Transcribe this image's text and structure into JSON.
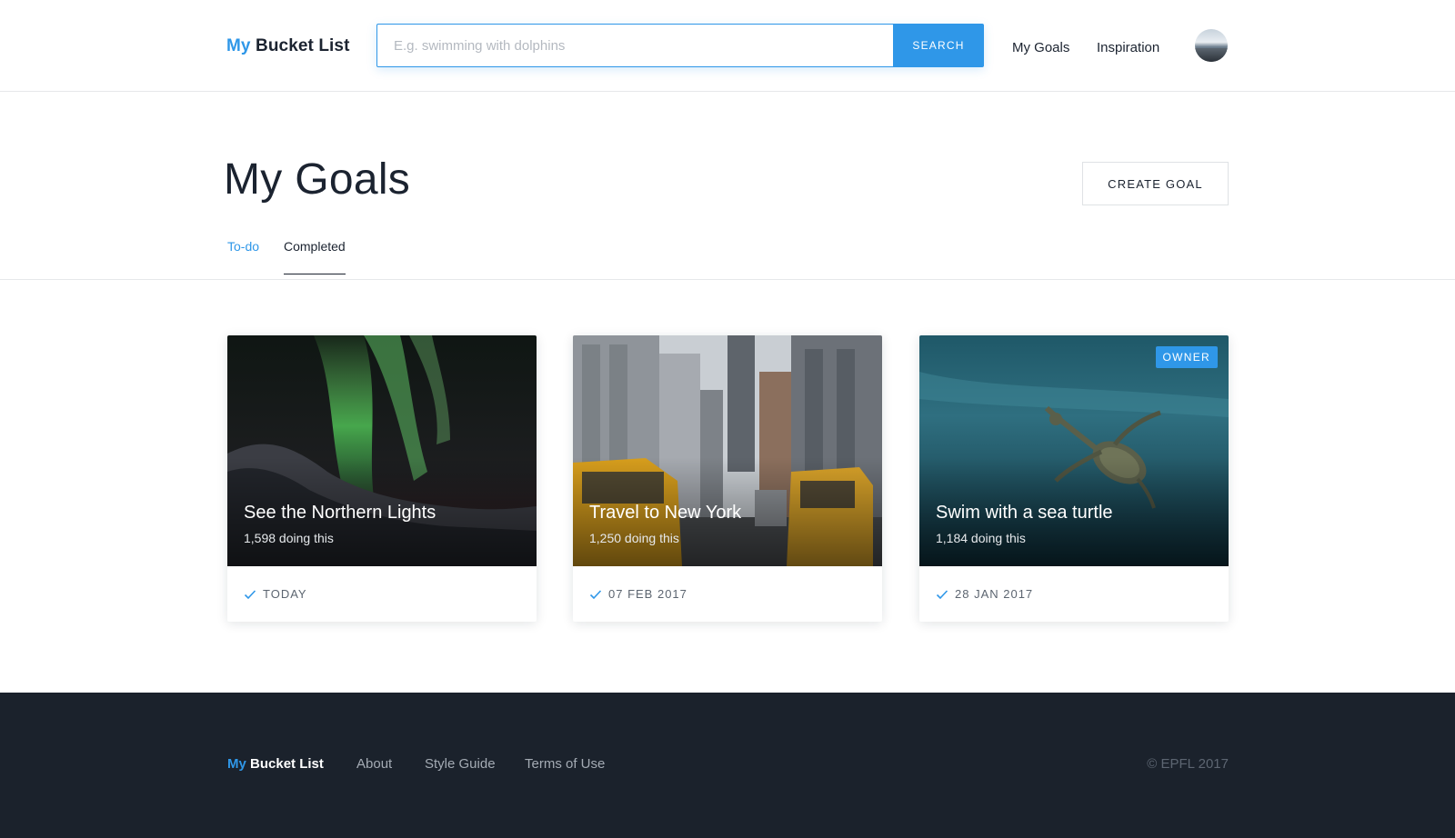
{
  "header": {
    "logo_my": "My",
    "logo_rest": "Bucket List",
    "search": {
      "placeholder": "E.g. swimming with dolphins",
      "value": "",
      "button_label": "SEARCH"
    },
    "nav": {
      "my_goals": "My Goals",
      "inspiration": "Inspiration"
    }
  },
  "main": {
    "title": "My Goals",
    "create_button": "CREATE GOAL",
    "tabs": [
      {
        "label": "To-do",
        "active": false
      },
      {
        "label": "Completed",
        "active": true
      }
    ],
    "cards": [
      {
        "title": "See the Northern Lights",
        "count": "1,598 doing this",
        "date": "TODAY",
        "badge": ""
      },
      {
        "title": "Travel to New York",
        "count": "1,250 doing this",
        "date": "07 FEB 2017",
        "badge": ""
      },
      {
        "title": "Swim with a sea turtle",
        "count": "1,184 doing this",
        "date": "28 JAN 2017",
        "badge": "OWNER"
      }
    ]
  },
  "footer": {
    "logo_my": "My",
    "logo_rest": "Bucket List",
    "links": [
      "About",
      "Style Guide",
      "Terms of Use"
    ],
    "copyright": "© EPFL 2017"
  },
  "icons": [
    "check-icon",
    "avatar-icon"
  ],
  "colors": {
    "accent": "#2f97e8",
    "text": "#1b2330",
    "footer_bg": "#1b222c"
  }
}
